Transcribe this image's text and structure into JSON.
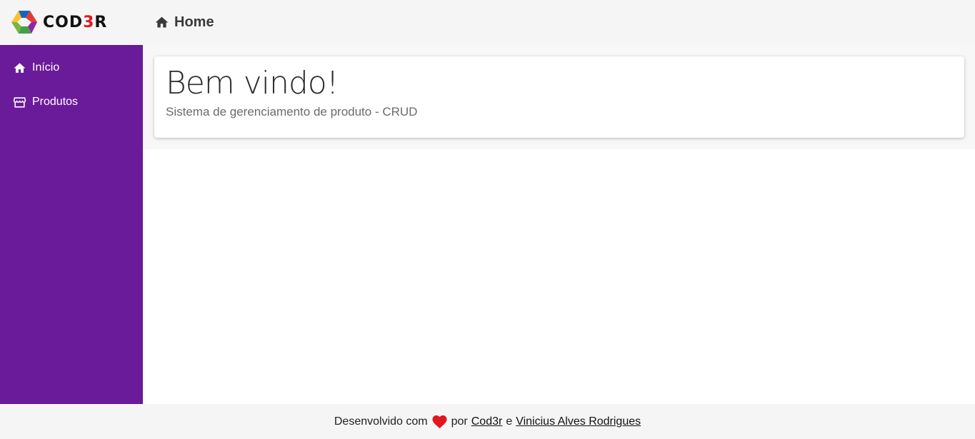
{
  "header": {
    "logo_text_a": "COD",
    "logo_text_b": "3",
    "logo_text_c": "R",
    "title": "Home",
    "title_icon": "home-icon"
  },
  "sidebar": {
    "background": "#6a1b9a",
    "items": [
      {
        "label": "Início",
        "icon": "home-icon"
      },
      {
        "label": "Produtos",
        "icon": "store-icon"
      }
    ]
  },
  "main": {
    "heading": "Bem vindo!",
    "subheading": "Sistema de gerenciamento de produto - CRUD"
  },
  "footer": {
    "text_before": "Desenvolvido com",
    "heart_icon": "heart-icon",
    "text_by": "por",
    "link_1": "Cod3r",
    "text_and": "e",
    "link_2": "Vinicius Alves Rodrigues",
    "heart_color": "#e3161e"
  }
}
